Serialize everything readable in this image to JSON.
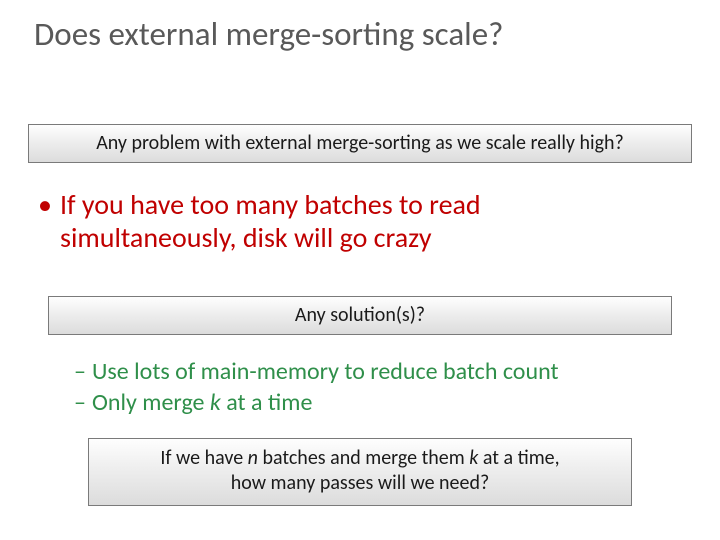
{
  "title": "Does external merge-sorting scale?",
  "banner1": "Any problem with external merge-sorting as we scale really high?",
  "bullet_dot": "•",
  "bullet_line1": "If you have too many batches to read",
  "bullet_line2": "simultaneously, disk will go crazy",
  "banner2": "Any solution(s)?",
  "dash": "–",
  "sub1": "Use lots of main-memory to reduce batch count",
  "sub2_a": "Only merge ",
  "sub2_k": "k",
  "sub2_b": " at a time",
  "banner3_a": "If we have ",
  "banner3_n": "n",
  "banner3_b": " batches and merge them ",
  "banner3_k": "k",
  "banner3_c": " at a time,",
  "banner3_line2": "how many passes will we need?"
}
